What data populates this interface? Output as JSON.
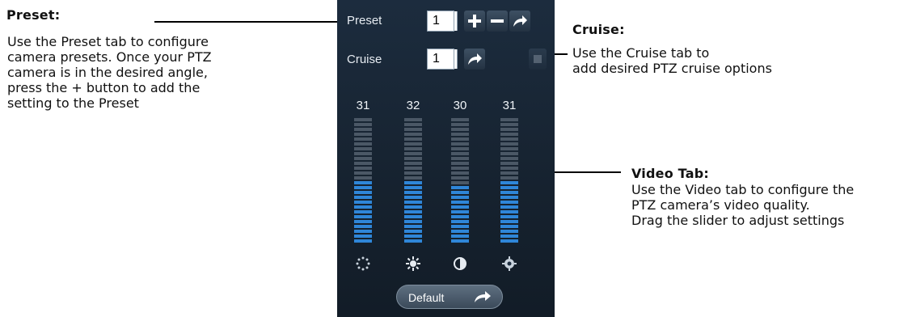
{
  "annotations": {
    "preset": {
      "title": "Preset:",
      "body": "Use the Preset tab to configure\ncamera presets. Once your PTZ\ncamera is in the desired angle,\npress the + button to add the\nsetting to the Preset"
    },
    "cruise": {
      "title": "Cruise:",
      "body": "Use the Cruise tab to\nadd desired PTZ cruise options"
    },
    "video": {
      "title": "Video Tab:",
      "body": "Use the Video tab to configure the\nPTZ camera’s video quality.\nDrag the slider to adjust settings"
    }
  },
  "panel": {
    "preset_label": "Preset",
    "preset_value": "1",
    "cruise_label": "Cruise",
    "cruise_value": "1",
    "default_label": "Default",
    "icons": [
      "plus-icon",
      "minus-icon",
      "go-arrow-icon",
      "cruise-go-arrow-icon",
      "brightness-icon",
      "saturation-icon",
      "contrast-icon",
      "hue-icon",
      "default-arrow-icon"
    ],
    "meters": [
      {
        "name": "brightness",
        "value": "31",
        "level": 0.5
      },
      {
        "name": "saturation",
        "value": "32",
        "level": 0.5
      },
      {
        "name": "contrast",
        "value": "30",
        "level": 0.48
      },
      {
        "name": "hue",
        "value": "31",
        "level": 0.5
      }
    ]
  },
  "colors": {
    "panel_bg": "#1c2c3e",
    "meter_on": "#2f86d8",
    "meter_off": "#4b5866"
  }
}
